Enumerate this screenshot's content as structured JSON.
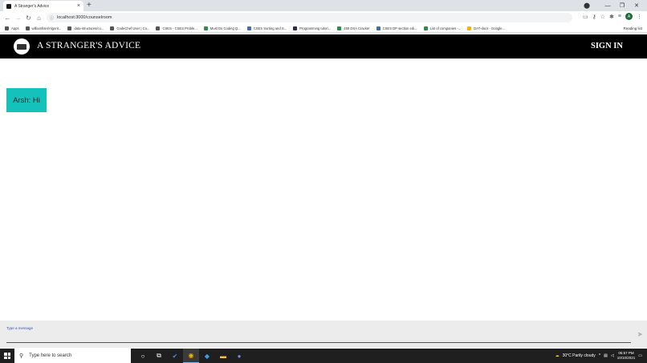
{
  "browser": {
    "tab_title": "A Stranger's Advice",
    "tab_close": "×",
    "new_tab": "+",
    "url": "localhost:3000/counselroom",
    "window_controls": [
      "—",
      "❐",
      "✕"
    ],
    "bookmarks": [
      "Apps",
      "williamfiset/Algorit...",
      "data-structures/co...",
      "CodeChef User | Co...",
      "CSES - CSES Proble...",
      "Must Do Coding Q...",
      "CSES Sorting and S...",
      "Programming tutori...",
      "450 DSA Cracker",
      "CSES DP section edi...",
      "List of companies -...",
      "DAT-docs - Google..."
    ],
    "reading_list": "Reading list",
    "profile_initial": "A"
  },
  "app": {
    "brand": "A STRANGER'S ADVICE",
    "signin_label": "SIGN IN"
  },
  "chat": {
    "messages": [
      {
        "text": "Arsh: Hi"
      }
    ]
  },
  "composer": {
    "label": "Type a message",
    "value": ""
  },
  "taskbar": {
    "search_placeholder": "Type here to search",
    "weather": "30°C  Partly cloudy",
    "time": "06:57 PM",
    "date": "10/10/2021"
  },
  "colors": {
    "navbar_bg": "#000000",
    "message_bg": "#14c2bb",
    "input_accent": "#3f51b5"
  }
}
